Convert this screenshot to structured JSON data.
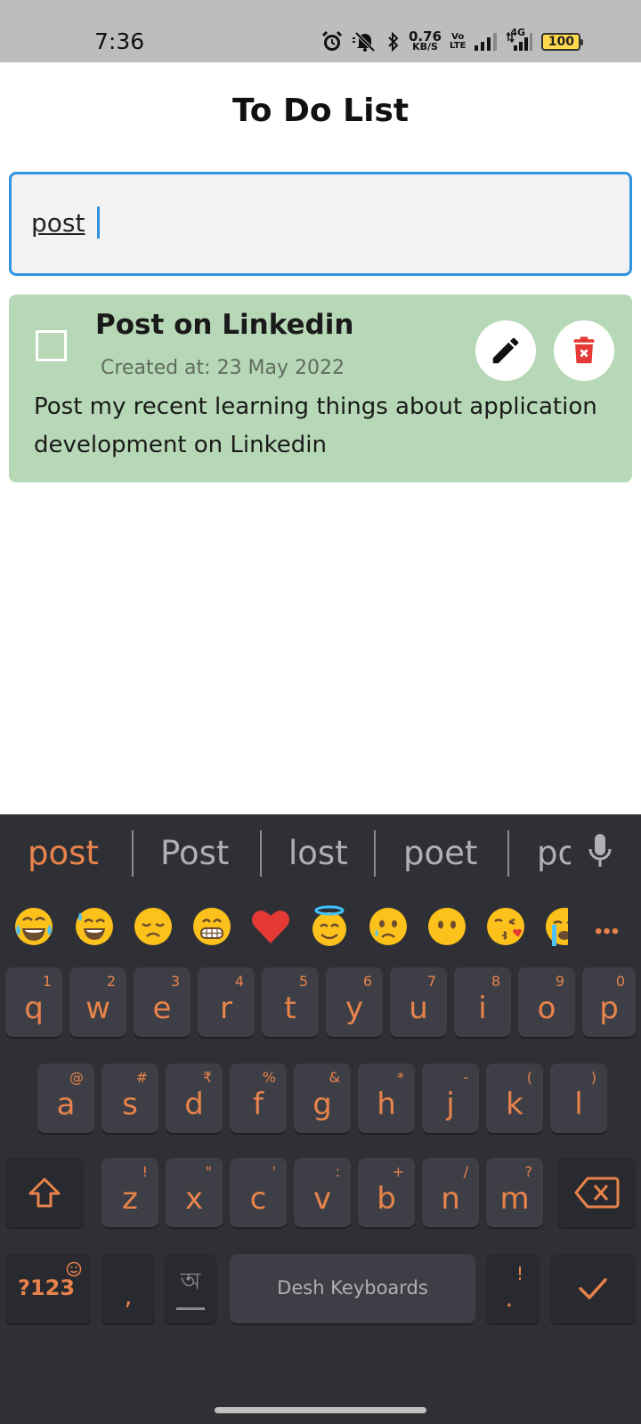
{
  "status_bar": {
    "time": "7:36",
    "net_speed_value": "0.76",
    "net_speed_unit": "KB/S",
    "volte_line1": "Vo",
    "volte_line2": "LTE",
    "network_type": "4G",
    "battery": "100",
    "icons": [
      "alarm-icon",
      "mute-icon",
      "bluetooth-icon",
      "signal-icon",
      "signal-4g-icon",
      "battery-icon"
    ]
  },
  "app": {
    "title": "To Do List",
    "search": {
      "value": "post",
      "placeholder": ""
    },
    "todos": [
      {
        "title": "Post on Linkedin",
        "created": "Created at: 23 May 2022",
        "description": "Post my recent learning things about application development on Linkedin",
        "checked": false
      }
    ],
    "colors": {
      "card_bg": "#b7d8b7",
      "focus_border": "#2f95e1",
      "delete_red": "#e53935"
    }
  },
  "keyboard": {
    "suggestions": [
      "post",
      "Post",
      "lost",
      "poet",
      "po"
    ],
    "emojis": [
      "joy",
      "sweat-smile",
      "disappointed",
      "grin",
      "heart",
      "innocent",
      "cry",
      "no-mouth",
      "kissing-heart",
      "sob"
    ],
    "more": "•••",
    "row1": [
      {
        "l": "q",
        "h": "1"
      },
      {
        "l": "w",
        "h": "2"
      },
      {
        "l": "e",
        "h": "3"
      },
      {
        "l": "r",
        "h": "4"
      },
      {
        "l": "t",
        "h": "5"
      },
      {
        "l": "y",
        "h": "6"
      },
      {
        "l": "u",
        "h": "7"
      },
      {
        "l": "i",
        "h": "8"
      },
      {
        "l": "o",
        "h": "9"
      },
      {
        "l": "p",
        "h": "0"
      }
    ],
    "row2": [
      {
        "l": "a",
        "h": "@"
      },
      {
        "l": "s",
        "h": "#"
      },
      {
        "l": "d",
        "h": "₹"
      },
      {
        "l": "f",
        "h": "%"
      },
      {
        "l": "g",
        "h": "&"
      },
      {
        "l": "h",
        "h": "*"
      },
      {
        "l": "j",
        "h": "-"
      },
      {
        "l": "k",
        "h": "("
      },
      {
        "l": "l",
        "h": ")"
      }
    ],
    "row3": [
      {
        "l": "z",
        "h": "!"
      },
      {
        "l": "x",
        "h": "\""
      },
      {
        "l": "c",
        "h": "'"
      },
      {
        "l": "v",
        "h": ":"
      },
      {
        "l": "b",
        "h": "+"
      },
      {
        "l": "n",
        "h": "/"
      },
      {
        "l": "m",
        "h": "?"
      }
    ],
    "symbols_label": "?123",
    "comma": ",",
    "lang_glyph": "অ",
    "space_label": "Desh Keyboards",
    "period": ".",
    "period_hint": "!",
    "accent": "#e8834b"
  }
}
